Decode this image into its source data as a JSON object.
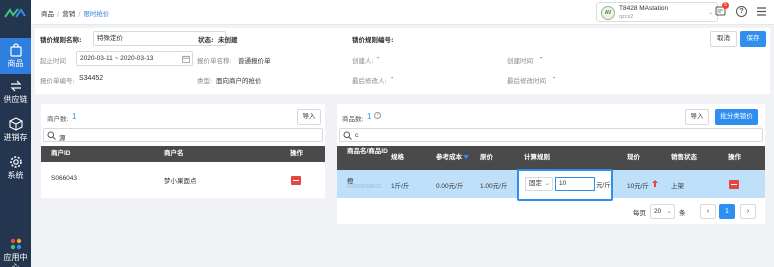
{
  "nav": {
    "items": [
      {
        "label": "商品",
        "icon": "bag-icon"
      },
      {
        "label": "供应链",
        "icon": "supply-chain-icon"
      },
      {
        "label": "进销存",
        "icon": "inventory-icon"
      },
      {
        "label": "系统",
        "icon": "gear-icon"
      },
      {
        "label": "应用中心",
        "icon": "apps-icon"
      }
    ]
  },
  "breadcrumb": [
    "商品",
    "营销",
    "限时抢价"
  ],
  "account": {
    "name": "T8428 MAstation",
    "sub": "qzcs2",
    "avatar": "AV"
  },
  "notifications": {
    "count": "5"
  },
  "help": {
    "label": "?"
  },
  "form": {
    "rule_name_label": "锁价规则名称:",
    "rule_name_value": "特殊定价",
    "status_label": "状态:",
    "status_value": "未创建",
    "rule_no_label": "锁价规则编号:",
    "cancel_label": "取消",
    "save_label": "保存",
    "time_label": "起止时间",
    "time_value": "2020-03-11 ~ 2020-03-13",
    "quote_name_label": "报价单名称:",
    "quote_name_value": "普通报价单",
    "creator_label": "创建人:",
    "creator_value": "-",
    "created_time_label": "创建时间",
    "created_time_value": "-",
    "quote_no_label": "报价单编号:",
    "quote_no_value": "S34452",
    "type_label": "类型:",
    "type_value": "面向商户的抢价",
    "modifier_label": "最后修改人:",
    "modifier_value": "-",
    "modified_time_label": "最后修改时间",
    "modified_time_value": "-"
  },
  "merchants": {
    "count_label": "商户数:",
    "count_value": "1",
    "import_label": "导入",
    "search_value": "源",
    "columns": [
      "商户ID",
      "商户名",
      "操作"
    ],
    "rows": [
      {
        "id": "S066043",
        "name": "梦小果面点"
      }
    ]
  },
  "products": {
    "count_label": "商品数:",
    "count_value": "1",
    "import_label": "导入",
    "batch_label": "批分类锁价",
    "search_value": "c",
    "columns": [
      "商品名/商品ID",
      "规格",
      "参考成本",
      "原价",
      "计算规则",
      "现价",
      "销售状态",
      "操作"
    ],
    "rows": [
      {
        "name": "橙",
        "id": "G5565098611",
        "spec": "1斤/斤",
        "ref_cost": "0.00元/斤",
        "price": "1.00元/斤",
        "rule_mode": "固定",
        "rule_value": "10",
        "rule_unit": "元/斤",
        "new_price": "10元/斤",
        "sale_status": "上架"
      }
    ]
  },
  "pager": {
    "per_page_label": "每页",
    "per_page_value": "20",
    "unit": "条",
    "prev": "‹",
    "page": "1",
    "next": "›"
  },
  "colors": {
    "nav_bg": "#24364f",
    "accent": "#2f8ff0",
    "danger": "#e4473f",
    "header_bg": "#4a4a4a",
    "selected_row": "#bfe0fa"
  }
}
